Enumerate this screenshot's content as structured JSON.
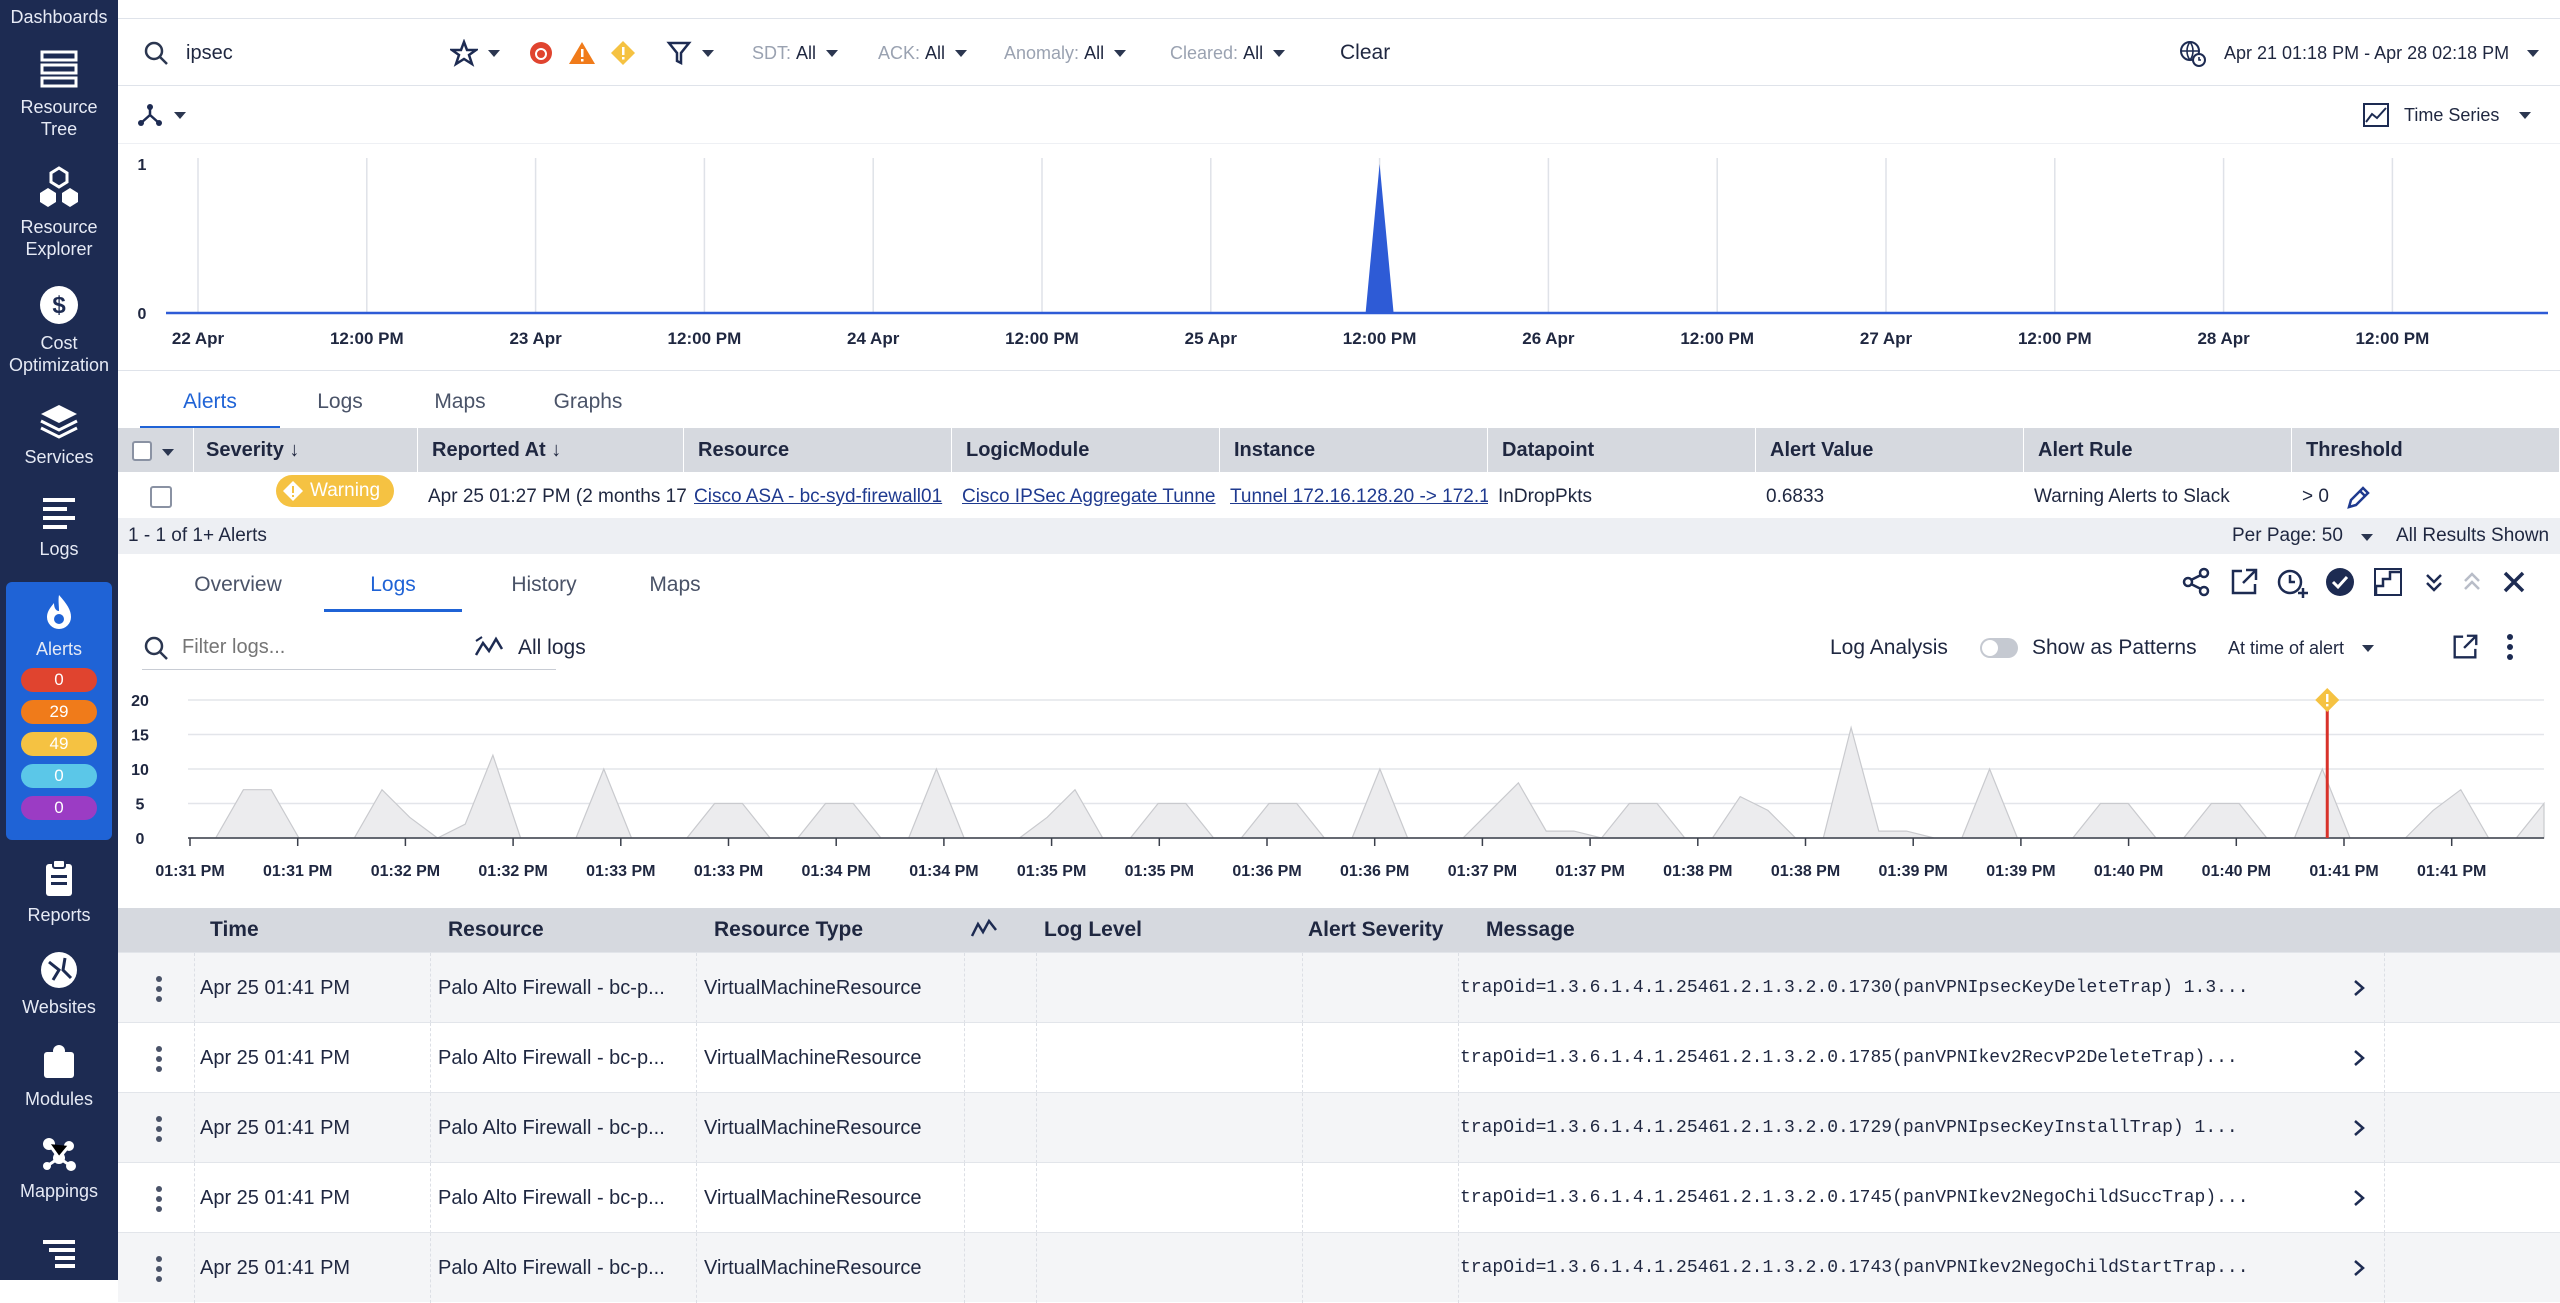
{
  "sidebar": {
    "items": [
      {
        "label": "Dashboards"
      },
      {
        "label": "Resource\nTree"
      },
      {
        "label": "Resource\nExplorer"
      },
      {
        "label": "Cost\nOptimization"
      },
      {
        "label": "Services"
      },
      {
        "label": "Logs"
      },
      {
        "label": "Alerts"
      },
      {
        "label": "Reports"
      },
      {
        "label": "Websites"
      },
      {
        "label": "Modules"
      },
      {
        "label": "Mappings"
      }
    ],
    "alert_counts": [
      "0",
      "29",
      "49",
      "0",
      "0"
    ],
    "alert_colors": [
      "#e0442f",
      "#f07b1a",
      "#f5c242",
      "#5bc7e8",
      "#9b3cc4"
    ]
  },
  "filters": {
    "search_value": "ipsec",
    "sdt": {
      "label": "SDT:",
      "value": "All"
    },
    "ack": {
      "label": "ACK:",
      "value": "All"
    },
    "anomaly": {
      "label": "Anomaly:",
      "value": "All"
    },
    "cleared": {
      "label": "Cleared:",
      "value": "All"
    },
    "clear_label": "Clear",
    "date_range": "Apr 21 01:18 PM - Apr 28 02:18 PM"
  },
  "view_select": "Time Series",
  "chart_data": [
    {
      "type": "area",
      "x_ticks": [
        "22 Apr",
        "12:00 PM",
        "23 Apr",
        "12:00 PM",
        "24 Apr",
        "12:00 PM",
        "25 Apr",
        "12:00 PM",
        "26 Apr",
        "12:00 PM",
        "27 Apr",
        "12:00 PM",
        "28 Apr",
        "12:00 PM"
      ],
      "y_ticks": [
        "0",
        "1"
      ],
      "ylim": [
        0,
        1
      ],
      "spike": {
        "x_index": 7,
        "value": 1
      }
    },
    {
      "type": "area",
      "x_ticks": [
        "01:31 PM",
        "01:31 PM",
        "01:32 PM",
        "01:32 PM",
        "01:33 PM",
        "01:33 PM",
        "01:34 PM",
        "01:34 PM",
        "01:35 PM",
        "01:35 PM",
        "01:36 PM",
        "01:36 PM",
        "01:37 PM",
        "01:37 PM",
        "01:38 PM",
        "01:38 PM",
        "01:39 PM",
        "01:39 PM",
        "01:40 PM",
        "01:40 PM",
        "01:41 PM",
        "01:41 PM"
      ],
      "y_ticks": [
        "0",
        "5",
        "10",
        "15",
        "20"
      ],
      "ylim": [
        0,
        20
      ],
      "values": [
        0,
        0,
        7,
        7,
        0,
        0,
        0,
        7,
        3,
        0,
        2,
        12,
        0,
        0,
        0,
        10,
        0,
        0,
        0,
        5,
        5,
        0,
        0,
        5,
        5,
        0,
        0,
        10,
        0,
        0,
        0,
        3,
        7,
        0,
        0,
        5,
        5,
        0,
        0,
        5,
        5,
        0,
        0,
        10,
        0,
        0,
        0,
        4,
        8,
        1,
        1,
        0,
        5,
        5,
        0,
        0,
        6,
        4,
        0,
        0,
        16,
        1,
        1,
        0,
        0,
        10,
        0,
        0,
        0,
        5,
        5,
        0,
        0,
        5,
        5,
        0,
        0,
        10,
        0,
        0,
        0,
        4,
        7,
        0,
        0,
        5
      ],
      "marker_fraction": 0.908
    }
  ],
  "detail_tabs": [
    "Alerts",
    "Logs",
    "Maps",
    "Graphs"
  ],
  "alert_table": {
    "headers": [
      "Severity",
      "Reported At",
      "Resource",
      "LogicModule",
      "Instance",
      "Datapoint",
      "Alert Value",
      "Alert Rule",
      "Threshold"
    ],
    "row": {
      "severity": "Warning",
      "reported_at": "Apr 25 01:27 PM  (2 months 17",
      "resource": "Cisco ASA - bc-syd-firewall01",
      "logic_module": "Cisco IPSec Aggregate Tunne",
      "instance": "Tunnel 172.16.128.20 -> 172.16.1",
      "datapoint": "InDropPkts",
      "alert_value": "0.6833",
      "alert_rule": "Warning Alerts to Slack",
      "threshold": "> 0"
    },
    "footer_left": "1 - 1 of 1+ Alerts",
    "per_page_label": "Per Page:",
    "per_page_value": "50",
    "all_results": "All Results Shown"
  },
  "alert_detail_tabs": [
    "Overview",
    "Logs",
    "History",
    "Maps"
  ],
  "logs": {
    "filter_placeholder": "Filter logs...",
    "all_logs": "All logs",
    "log_analysis": "Log Analysis",
    "show_patterns": "Show as Patterns",
    "time_scope": "At time of alert",
    "headers": [
      "Time",
      "Resource",
      "Resource Type",
      "Log Level",
      "Alert Severity",
      "Message"
    ],
    "rows": [
      {
        "time": "Apr 25 01:41 PM",
        "resource": "Palo Alto Firewall - bc-p...",
        "type": "VirtualMachineResource",
        "message": "trapOid=1.3.6.1.4.1.25461.2.1.3.2.0.1730(panVPNIpsecKeyDeleteTrap) 1.3..."
      },
      {
        "time": "Apr 25 01:41 PM",
        "resource": "Palo Alto Firewall - bc-p...",
        "type": "VirtualMachineResource",
        "message": "trapOid=1.3.6.1.4.1.25461.2.1.3.2.0.1785(panVPNIkev2RecvP2DeleteTrap)..."
      },
      {
        "time": "Apr 25 01:41 PM",
        "resource": "Palo Alto Firewall - bc-p...",
        "type": "VirtualMachineResource",
        "message": "trapOid=1.3.6.1.4.1.25461.2.1.3.2.0.1729(panVPNIpsecKeyInstallTrap) 1..."
      },
      {
        "time": "Apr 25 01:41 PM",
        "resource": "Palo Alto Firewall - bc-p...",
        "type": "VirtualMachineResource",
        "message": "trapOid=1.3.6.1.4.1.25461.2.1.3.2.0.1745(panVPNIkev2NegoChildSuccTrap)..."
      },
      {
        "time": "Apr 25 01:41 PM",
        "resource": "Palo Alto Firewall - bc-p...",
        "type": "VirtualMachineResource",
        "message": "trapOid=1.3.6.1.4.1.25461.2.1.3.2.0.1743(panVPNIkev2NegoChildStartTrap..."
      }
    ]
  }
}
